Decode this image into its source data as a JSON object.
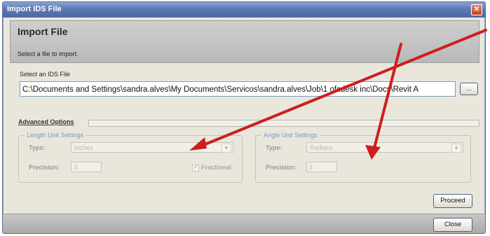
{
  "window": {
    "title": "Import IDS File",
    "close_glyph": "✕"
  },
  "banner": {
    "heading": "Import File",
    "subtitle": "Select a file to import."
  },
  "file": {
    "label": "Select an IDS File",
    "path": "C:\\Documents and Settings\\sandra.alves\\My Documents\\Servicos\\sandra.alves\\Job\\1 ofcdesk inc\\Docs\\Revit A",
    "browse_label": "..."
  },
  "advanced": {
    "label": "Advanced Options"
  },
  "length": {
    "legend": "Length Unit Settings",
    "type_label": "Type:",
    "type_value": "Inches",
    "precision_label": "Precision:",
    "precision_value": "3",
    "fractional_label": "Fractional"
  },
  "angle": {
    "legend": "Angle Unit Settings",
    "type_label": "Type:",
    "type_value": "Radians",
    "precision_label": "Precision:",
    "precision_value": "3"
  },
  "buttons": {
    "proceed": "Proceed",
    "close": "Close"
  },
  "icons": {
    "dropdown": "chevron-down-icon",
    "check": "checkmark-icon"
  },
  "colors": {
    "arrow": "#cc1f1f",
    "titlebar": "#5d79b4"
  }
}
